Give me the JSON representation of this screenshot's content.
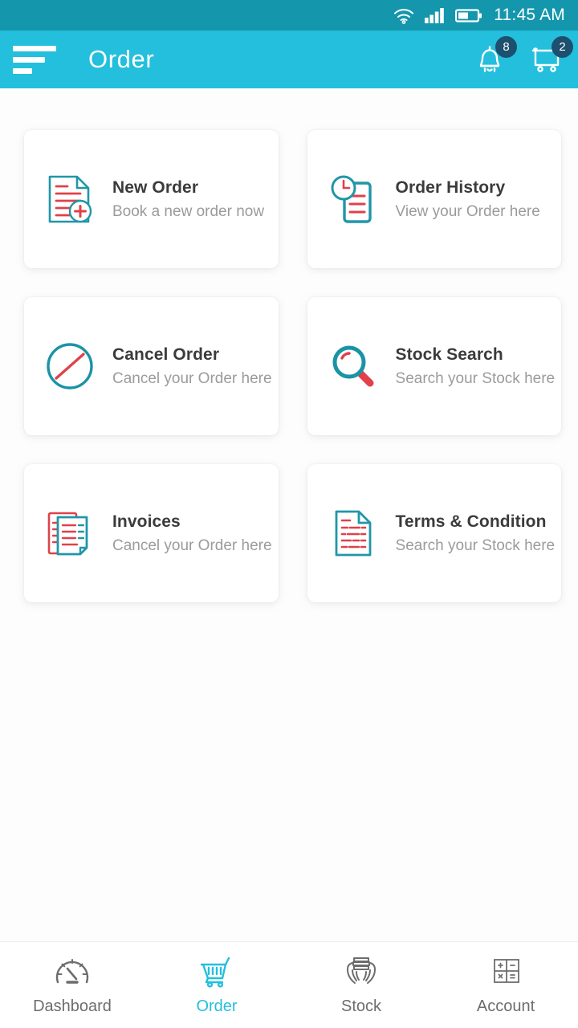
{
  "status_bar": {
    "time": "11:45 AM",
    "icons": [
      "wifi-icon",
      "signal-icon",
      "battery-icon"
    ],
    "background": "#1496ad"
  },
  "app_bar": {
    "title": "Order",
    "background": "#23bfdc",
    "menu_icon": "hamburger-menu-icon",
    "actions": [
      {
        "icon": "notification-bell-icon",
        "badge": "8"
      },
      {
        "icon": "shopping-cart-icon",
        "badge": "2"
      }
    ],
    "badge_color": "#1d4f6e"
  },
  "menu_cards": [
    {
      "title": "New Order",
      "subtitle": "Book a new order now",
      "icon": "new-order-document-icon"
    },
    {
      "title": "Order History",
      "subtitle": "View your Order here",
      "icon": "order-history-clock-icon"
    },
    {
      "title": "Cancel Order",
      "subtitle": "Cancel your Order here",
      "icon": "cancel-order-prohibit-icon"
    },
    {
      "title": "Stock Search",
      "subtitle": "Search your Stock here",
      "icon": "stock-search-magnifier-icon"
    },
    {
      "title": "Invoices",
      "subtitle": "Cancel your Order here",
      "icon": "invoices-documents-icon"
    },
    {
      "title": "Terms & Condition",
      "subtitle": "Search your Stock here",
      "icon": "terms-document-icon"
    }
  ],
  "bottom_nav": {
    "active": "Order",
    "items": [
      {
        "label": "Dashboard",
        "icon": "speedometer-icon"
      },
      {
        "label": "Order",
        "icon": "shopping-cart-icon"
      },
      {
        "label": "Stock",
        "icon": "hands-holding-books-icon"
      },
      {
        "label": "Account",
        "icon": "calculator-icon"
      }
    ],
    "active_color": "#23bfdc",
    "inactive_color": "#6d6d6d"
  },
  "theme": {
    "accent_teal": "#2196a8",
    "accent_red": "#e0414a",
    "card_title_color": "#3b3b3b",
    "card_subtitle_color": "#9b9b9b",
    "page_background": "#fdfdfd"
  }
}
